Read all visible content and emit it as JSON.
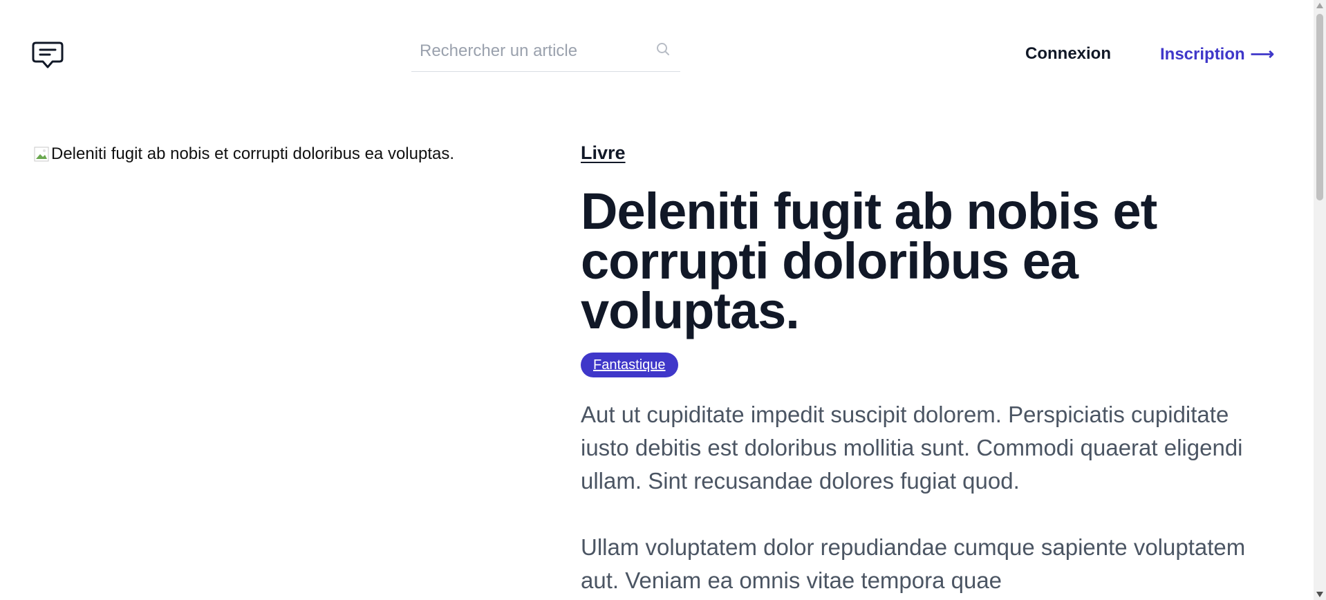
{
  "header": {
    "logo_icon": "chat-bubble-icon",
    "search": {
      "placeholder": "Rechercher un article",
      "value": "",
      "icon": "search-icon"
    },
    "login_label": "Connexion",
    "signup_label": "Inscription",
    "signup_arrow": "⟶"
  },
  "article": {
    "image_alt": "Deleniti fugit ab nobis et corrupti doloribus ea voluptas.",
    "category": "Livre",
    "title": "Deleniti fugit ab nobis et corrupti doloribus ea voluptas.",
    "tag": "Fantastique",
    "paragraphs": [
      "Aut ut cupiditate impedit suscipit dolorem. Perspiciatis cupiditate iusto debitis est doloribus mollitia sunt. Commodi quaerat eligendi ullam. Sint recusandae dolores fugiat quod.",
      "Ullam voluptatem dolor repudiandae cumque sapiente voluptatem aut. Veniam ea omnis vitae tempora quae"
    ]
  },
  "colors": {
    "accent": "#3f37c9",
    "heading": "#111827",
    "body_text": "#4b5563",
    "placeholder": "#9aa1ad"
  }
}
